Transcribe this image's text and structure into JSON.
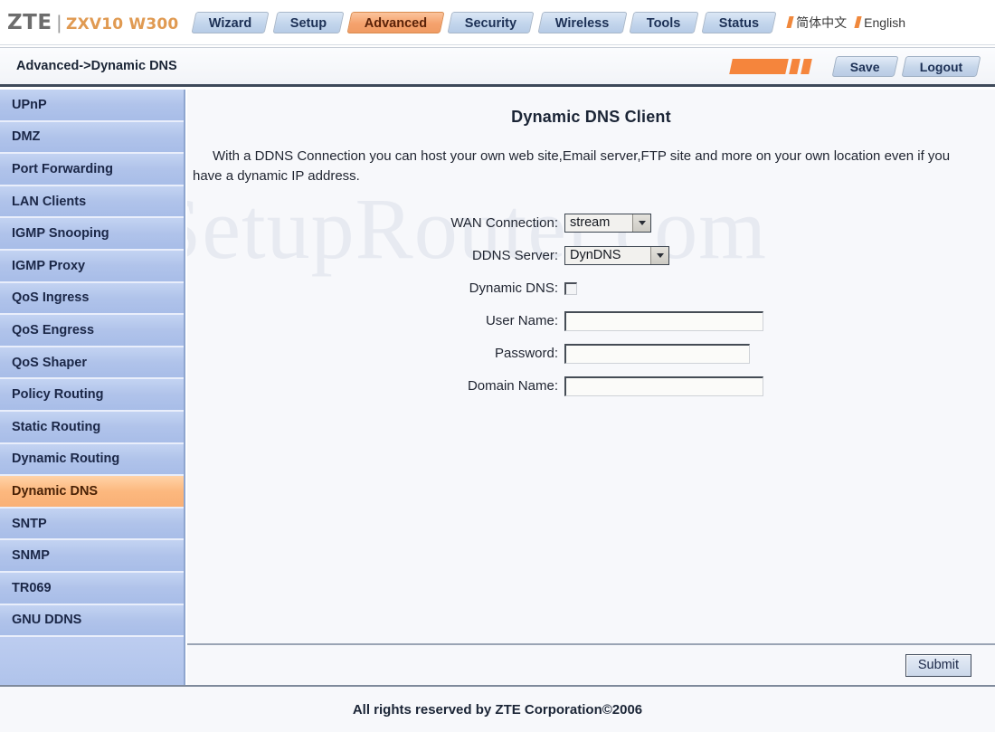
{
  "header": {
    "brand_primary": "ZTE",
    "brand_separator": "|",
    "brand_model": "ZXV10 W300",
    "tabs": [
      {
        "label": "Wizard",
        "active": false
      },
      {
        "label": "Setup",
        "active": false
      },
      {
        "label": "Advanced",
        "active": true
      },
      {
        "label": "Security",
        "active": false
      },
      {
        "label": "Wireless",
        "active": false
      },
      {
        "label": "Tools",
        "active": false
      },
      {
        "label": "Status",
        "active": false
      }
    ],
    "languages": [
      {
        "label": "简体中文"
      },
      {
        "label": "English"
      }
    ],
    "active_tab_color": "#f5a26d",
    "tab_color": "#c3d5ec"
  },
  "crumbbar": {
    "breadcrumb": "Advanced->Dynamic DNS",
    "save_label": "Save",
    "logout_label": "Logout",
    "decor_color": "#f5853c"
  },
  "sidebar": {
    "items": [
      {
        "label": "UPnP",
        "active": false
      },
      {
        "label": "DMZ",
        "active": false
      },
      {
        "label": "Port Forwarding",
        "active": false
      },
      {
        "label": "LAN Clients",
        "active": false
      },
      {
        "label": "IGMP Snooping",
        "active": false
      },
      {
        "label": "IGMP Proxy",
        "active": false
      },
      {
        "label": "QoS Ingress",
        "active": false
      },
      {
        "label": "QoS Engress",
        "active": false
      },
      {
        "label": "QoS Shaper",
        "active": false
      },
      {
        "label": "Policy Routing",
        "active": false
      },
      {
        "label": "Static Routing",
        "active": false
      },
      {
        "label": "Dynamic Routing",
        "active": false
      },
      {
        "label": "Dynamic DNS",
        "active": true
      },
      {
        "label": "SNTP",
        "active": false
      },
      {
        "label": "SNMP",
        "active": false
      },
      {
        "label": "TR069",
        "active": false
      },
      {
        "label": "GNU DDNS",
        "active": false
      }
    ],
    "active_color": "#fcb87e",
    "background_color": "#aec2ea"
  },
  "main": {
    "watermark": "SetupRouter.com",
    "title": "Dynamic DNS Client",
    "description": "With a DDNS Connection you can host your own web site,Email server,FTP site and more on your own location even if you have a dynamic IP address.",
    "fields": {
      "wan_connection": {
        "label": "WAN Connection:",
        "value": "stream"
      },
      "ddns_server": {
        "label": "DDNS Server:",
        "value": "DynDNS"
      },
      "dynamic_dns": {
        "label": "Dynamic DNS:",
        "checked": false
      },
      "user_name": {
        "label": "User Name:",
        "value": "",
        "placeholder": ""
      },
      "password": {
        "label": "Password:",
        "value": "",
        "placeholder": ""
      },
      "domain_name": {
        "label": "Domain Name:",
        "value": "",
        "placeholder": ""
      }
    },
    "submit_label": "Submit"
  },
  "footer": {
    "text": "All rights reserved by ZTE Corporation©2006"
  }
}
